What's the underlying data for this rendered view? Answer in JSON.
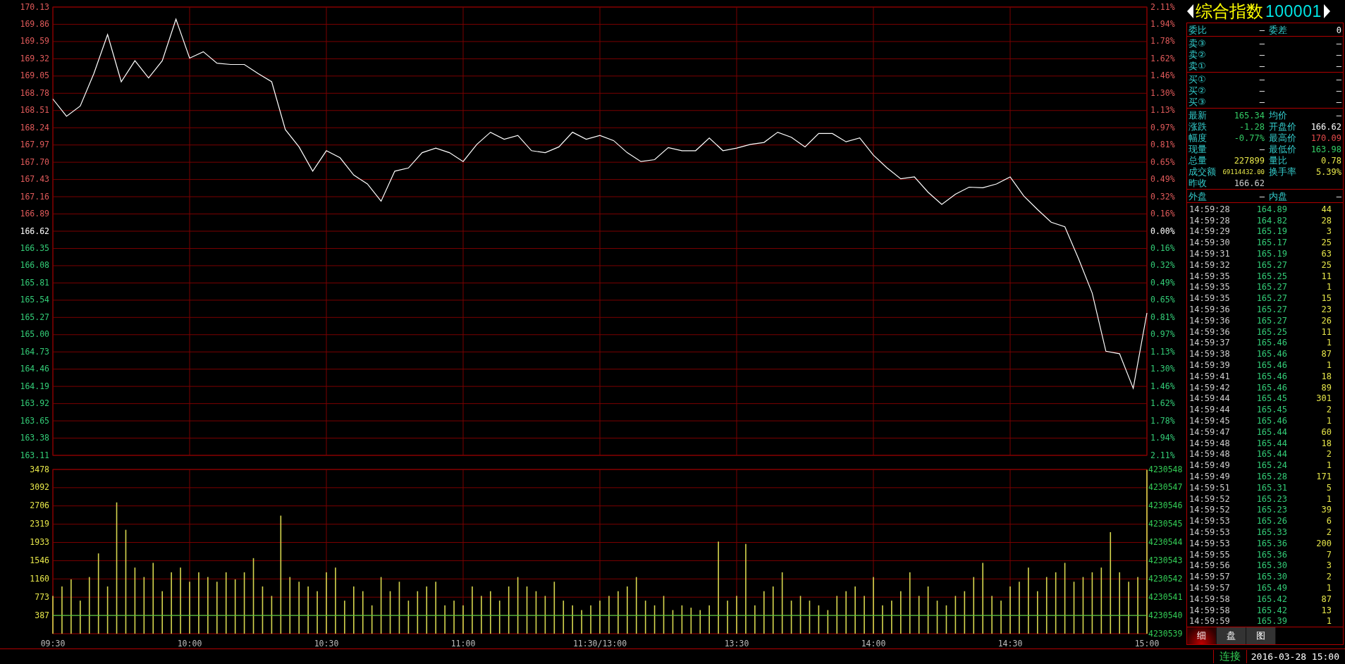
{
  "price_panel": {
    "chart_data": {
      "type": "line",
      "grid": true,
      "ylim": [
        163.11,
        170.13
      ],
      "yticks": [
        {
          "value": 170.13,
          "label": "170.13"
        },
        {
          "value": 169.86,
          "label": "169.86"
        },
        {
          "value": 169.59,
          "label": "169.59"
        },
        {
          "value": 169.32,
          "label": "169.32"
        },
        {
          "value": 169.05,
          "label": "169.05"
        },
        {
          "value": 168.78,
          "label": "168.78"
        },
        {
          "value": 168.51,
          "label": "168.51"
        },
        {
          "value": 168.24,
          "label": "168.24"
        },
        {
          "value": 167.97,
          "label": "167.97"
        },
        {
          "value": 167.7,
          "label": "167.70"
        },
        {
          "value": 167.43,
          "label": "167.43"
        },
        {
          "value": 167.16,
          "label": "167.16"
        },
        {
          "value": 166.89,
          "label": "166.89"
        },
        {
          "value": 166.62,
          "label": "166.62"
        },
        {
          "value": 166.35,
          "label": "166.35"
        },
        {
          "value": 166.08,
          "label": "166.08"
        },
        {
          "value": 165.81,
          "label": "165.81"
        },
        {
          "value": 165.54,
          "label": "165.54"
        },
        {
          "value": 165.27,
          "label": "165.27"
        },
        {
          "value": 165.0,
          "label": "165.00"
        },
        {
          "value": 164.73,
          "label": "164.73"
        },
        {
          "value": 164.46,
          "label": "164.46"
        },
        {
          "value": 164.19,
          "label": "164.19"
        },
        {
          "value": 163.92,
          "label": "163.92"
        },
        {
          "value": 163.65,
          "label": "163.65"
        },
        {
          "value": 163.38,
          "label": "163.38"
        },
        {
          "value": 163.11,
          "label": "163.11"
        }
      ],
      "series": [
        {
          "color": "#ffffff",
          "values": [
            168.69,
            168.42,
            168.58,
            169.09,
            169.7,
            168.96,
            169.29,
            169.02,
            169.29,
            169.94,
            169.33,
            169.43,
            169.25,
            169.23,
            169.23,
            169.09,
            168.96,
            168.21,
            167.94,
            167.56,
            167.88,
            167.77,
            167.5,
            167.36,
            167.09,
            167.56,
            167.61,
            167.85,
            167.92,
            167.85,
            167.71,
            167.98,
            168.17,
            168.06,
            168.12,
            167.88,
            167.85,
            167.94,
            168.17,
            168.06,
            168.12,
            168.04,
            167.85,
            167.71,
            167.74,
            167.93,
            167.88,
            167.88,
            168.08,
            167.88,
            167.92,
            167.98,
            168.01,
            168.17,
            168.09,
            167.94,
            168.15,
            168.15,
            168.02,
            168.08,
            167.81,
            167.61,
            167.44,
            167.47,
            167.23,
            167.04,
            167.2,
            167.31,
            167.3,
            167.36,
            167.47,
            167.17,
            166.96,
            166.76,
            166.69,
            166.19,
            165.65,
            164.74,
            164.7,
            164.16,
            165.34
          ]
        }
      ]
    },
    "right_axis_labels": [
      "2.11%",
      "1.94%",
      "1.78%",
      "1.62%",
      "1.46%",
      "1.30%",
      "1.13%",
      "0.97%",
      "0.81%",
      "0.65%",
      "0.49%",
      "0.32%",
      "0.16%",
      "0.00%",
      "0.16%",
      "0.32%",
      "0.49%",
      "0.65%",
      "0.81%",
      "0.97%",
      "1.13%",
      "1.30%",
      "1.46%",
      "1.62%",
      "1.78%",
      "1.94%",
      "2.11%"
    ]
  },
  "volume_panel": {
    "chart_data": {
      "type": "bar",
      "grid": true,
      "ylim": [
        0,
        3478
      ],
      "categories": [
        "09:30",
        null,
        null,
        null,
        null,
        null,
        null,
        null,
        null,
        null,
        null,
        null,
        null,
        null,
        null,
        "10:00",
        null,
        null,
        null,
        null,
        null,
        null,
        null,
        null,
        null,
        null,
        null,
        null,
        null,
        null,
        "10:30",
        null,
        null,
        null,
        null,
        null,
        null,
        null,
        null,
        null,
        null,
        null,
        null,
        null,
        null,
        "11:00",
        null,
        null,
        null,
        null,
        null,
        null,
        null,
        null,
        null,
        null,
        null,
        null,
        null,
        null,
        "11:30/13:00",
        null,
        null,
        null,
        null,
        null,
        null,
        null,
        null,
        null,
        null,
        null,
        null,
        null,
        null,
        "13:30",
        null,
        null,
        null,
        null,
        null,
        null,
        null,
        null,
        null,
        null,
        null,
        null,
        null,
        null,
        "14:00",
        null,
        null,
        null,
        null,
        null,
        null,
        null,
        null,
        null,
        null,
        null,
        null,
        null,
        null,
        "14:30",
        null,
        null,
        null,
        null,
        null,
        null,
        null,
        null,
        null,
        null,
        null,
        null,
        null,
        null,
        "15:00"
      ],
      "yticks": [
        387,
        773,
        1160,
        1546,
        1933,
        2319,
        2706,
        3092,
        3478
      ],
      "series": [
        {
          "color": "#d6d64e",
          "values": [
            800,
            1000,
            1150,
            700,
            1200,
            1700,
            1000,
            2780,
            2200,
            1400,
            1200,
            1500,
            900,
            1300,
            1400,
            1100,
            1300,
            1200,
            1100,
            1300,
            1150,
            1300,
            1600,
            1000,
            800,
            2500,
            1200,
            1100,
            1000,
            900,
            1300,
            1400,
            700,
            1000,
            900,
            600,
            1200,
            900,
            1100,
            700,
            900,
            1000,
            1100,
            600,
            700,
            600,
            1000,
            800,
            900,
            700,
            1000,
            1200,
            1000,
            900,
            800,
            1100,
            700,
            600,
            500,
            600,
            700,
            800,
            900,
            1000,
            1200,
            700,
            600,
            800,
            500,
            600,
            550,
            500,
            600,
            1950,
            700,
            800,
            1900,
            600,
            900,
            1000,
            1300,
            700,
            800,
            700,
            600,
            500,
            800,
            900,
            1000,
            800,
            1200,
            600,
            700,
            900,
            1300,
            800,
            1000,
            700,
            600,
            800,
            900,
            1200,
            1500,
            800,
            700,
            1000,
            1100,
            1400,
            900,
            1200,
            1300,
            1500,
            1100,
            1200,
            1300,
            1400,
            2150,
            1300,
            1100,
            1200,
            3470
          ]
        },
        {
          "type": "line",
          "color": "#44cc44",
          "values": [
            387,
            387,
            387,
            387,
            387,
            387,
            387,
            387,
            387,
            387,
            387,
            387,
            387,
            387,
            387,
            387,
            387,
            387,
            387,
            387,
            387,
            387,
            387,
            387,
            387,
            387,
            387,
            387,
            387,
            387,
            387,
            387,
            387,
            387,
            387,
            387,
            387,
            387,
            387,
            387,
            387,
            387,
            387,
            387,
            387,
            387,
            387,
            387,
            387,
            387,
            387,
            387,
            387,
            387,
            387,
            387,
            387,
            387,
            387,
            387,
            387,
            387,
            387,
            387,
            387,
            387,
            387,
            387,
            387,
            387,
            387,
            387,
            387,
            387,
            387,
            387,
            387,
            387,
            387,
            387,
            387,
            387,
            387,
            387,
            387,
            387,
            387,
            387,
            387,
            387,
            387,
            387,
            387,
            387,
            387,
            387,
            387,
            387,
            387,
            387,
            387,
            387,
            387,
            387,
            387,
            387,
            387,
            387,
            387,
            387,
            387,
            387,
            387,
            387,
            387,
            387,
            387,
            387,
            387,
            387,
            387
          ]
        }
      ]
    },
    "right_axis_labels": [
      "4230548",
      "4230547",
      "4230546",
      "4230545",
      "4230544",
      "4230543",
      "4230542",
      "4230541",
      "4230540",
      "4230539"
    ]
  },
  "sidebar": {
    "name": "综合指数",
    "code": "100001",
    "ratio_row": {
      "label": "委比",
      "value": "—",
      "label2": "委差",
      "value2": "0"
    },
    "asks": [
      {
        "label": "卖③",
        "price": "—",
        "volume": "—"
      },
      {
        "label": "卖②",
        "price": "—",
        "volume": "—"
      },
      {
        "label": "卖①",
        "price": "—",
        "volume": "—"
      }
    ],
    "bids": [
      {
        "label": "买①",
        "price": "—",
        "volume": "—"
      },
      {
        "label": "买②",
        "price": "—",
        "volume": "—"
      },
      {
        "label": "买③",
        "price": "—",
        "volume": "—"
      }
    ],
    "stats": [
      {
        "left": {
          "label": "最新",
          "value": "165.34",
          "color": "#33cc66"
        },
        "right": {
          "label": "均价",
          "value": "—"
        }
      },
      {
        "left": {
          "label": "涨跌",
          "value": "-1.28",
          "color": "#33cc66"
        },
        "right": {
          "label": "开盘价",
          "value": "166.62",
          "color": "#ffffff"
        }
      },
      {
        "left": {
          "label": "幅度",
          "value": "-0.77%",
          "color": "#33cc66"
        },
        "right": {
          "label": "最高价",
          "value": "170.09",
          "color": "#e64c4c"
        }
      },
      {
        "left": {
          "label": "现量",
          "value": "—"
        },
        "right": {
          "label": "最低价",
          "value": "163.98",
          "color": "#33cc66"
        }
      },
      {
        "left": {
          "label": "总量",
          "value": "227899",
          "color": "#e6e64a"
        },
        "right": {
          "label": "量比",
          "value": "0.78",
          "color": "#e6e64a"
        }
      },
      {
        "left": {
          "label": "成交额",
          "value": "69114432.00",
          "color": "#e6e64a"
        },
        "right": {
          "label": "换手率",
          "value": "5.39%",
          "color": "#e6e64a"
        }
      },
      {
        "left": {
          "label": "昨收",
          "value": "166.62",
          "color": "#cccccc"
        }
      }
    ],
    "flow_row": {
      "label": "外盘",
      "value": "—",
      "label2": "内盘",
      "value2": "—"
    },
    "trades": [
      {
        "time": "14:59:28",
        "price": "164.89",
        "volume": "44"
      },
      {
        "time": "14:59:28",
        "price": "164.82",
        "volume": "28"
      },
      {
        "time": "14:59:29",
        "price": "165.19",
        "volume": "3"
      },
      {
        "time": "14:59:30",
        "price": "165.17",
        "volume": "25"
      },
      {
        "time": "14:59:31",
        "price": "165.19",
        "volume": "63"
      },
      {
        "time": "14:59:32",
        "price": "165.27",
        "volume": "25"
      },
      {
        "time": "14:59:35",
        "price": "165.25",
        "volume": "11"
      },
      {
        "time": "14:59:35",
        "price": "165.27",
        "volume": "1"
      },
      {
        "time": "14:59:35",
        "price": "165.27",
        "volume": "15"
      },
      {
        "time": "14:59:36",
        "price": "165.27",
        "volume": "23"
      },
      {
        "time": "14:59:36",
        "price": "165.27",
        "volume": "26"
      },
      {
        "time": "14:59:36",
        "price": "165.25",
        "volume": "11"
      },
      {
        "time": "14:59:37",
        "price": "165.46",
        "volume": "1"
      },
      {
        "time": "14:59:38",
        "price": "165.46",
        "volume": "87"
      },
      {
        "time": "14:59:39",
        "price": "165.46",
        "volume": "1"
      },
      {
        "time": "14:59:41",
        "price": "165.46",
        "volume": "18"
      },
      {
        "time": "14:59:42",
        "price": "165.46",
        "volume": "89"
      },
      {
        "time": "14:59:44",
        "price": "165.45",
        "volume": "301"
      },
      {
        "time": "14:59:44",
        "price": "165.45",
        "volume": "2"
      },
      {
        "time": "14:59:45",
        "price": "165.46",
        "volume": "1"
      },
      {
        "time": "14:59:47",
        "price": "165.44",
        "volume": "60"
      },
      {
        "time": "14:59:48",
        "price": "165.44",
        "volume": "18"
      },
      {
        "time": "14:59:48",
        "price": "165.44",
        "volume": "2"
      },
      {
        "time": "14:59:49",
        "price": "165.24",
        "volume": "1"
      },
      {
        "time": "14:59:49",
        "price": "165.28",
        "volume": "171"
      },
      {
        "time": "14:59:51",
        "price": "165.31",
        "volume": "5"
      },
      {
        "time": "14:59:52",
        "price": "165.23",
        "volume": "1"
      },
      {
        "time": "14:59:52",
        "price": "165.23",
        "volume": "39"
      },
      {
        "time": "14:59:53",
        "price": "165.26",
        "volume": "6"
      },
      {
        "time": "14:59:53",
        "price": "165.33",
        "volume": "2"
      },
      {
        "time": "14:59:53",
        "price": "165.36",
        "volume": "200"
      },
      {
        "time": "14:59:55",
        "price": "165.36",
        "volume": "7"
      },
      {
        "time": "14:59:56",
        "price": "165.30",
        "volume": "3"
      },
      {
        "time": "14:59:57",
        "price": "165.30",
        "volume": "2"
      },
      {
        "time": "14:59:57",
        "price": "165.49",
        "volume": "1"
      },
      {
        "time": "14:59:58",
        "price": "165.42",
        "volume": "87"
      },
      {
        "time": "14:59:58",
        "price": "165.42",
        "volume": "13"
      },
      {
        "time": "14:59:59",
        "price": "165.39",
        "volume": "1"
      }
    ],
    "tabs": [
      {
        "label": "细",
        "selected": true
      },
      {
        "label": "盘",
        "selected": false
      },
      {
        "label": "图",
        "selected": false
      }
    ]
  },
  "status_bar": {
    "connection": "连接",
    "datetime": "2016-03-28 15:00"
  }
}
